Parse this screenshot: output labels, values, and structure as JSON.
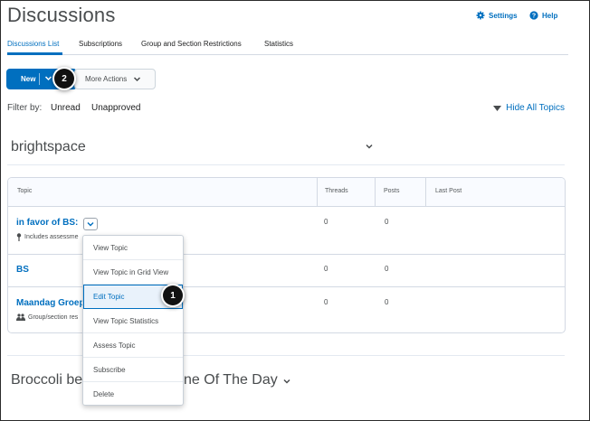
{
  "page": {
    "title": "Discussions"
  },
  "header_links": {
    "settings": "Settings",
    "help": "Help"
  },
  "tabs": [
    "Discussions List",
    "Subscriptions",
    "Group and Section Restrictions",
    "Statistics"
  ],
  "toolbar": {
    "new_label": "New",
    "more_actions_label": "More Actions"
  },
  "callouts": {
    "first": "1",
    "second": "2"
  },
  "filter": {
    "label": "Filter by:",
    "unread": "Unread",
    "unapproved": "Unapproved",
    "hide_all_topics": "Hide All Topics"
  },
  "forum": {
    "title": "brightspace"
  },
  "table": {
    "headers": {
      "topic": "Topic",
      "threads": "Threads",
      "posts": "Posts",
      "last_post": "Last Post"
    },
    "rows": [
      {
        "topic": "in favor of BS:",
        "note": "Includes assessme",
        "threads": "0",
        "posts": "0"
      },
      {
        "topic": "BS",
        "threads": "0",
        "posts": "0"
      },
      {
        "topic": "Maandag Groep",
        "note": "Group/section res",
        "threads": "0",
        "posts": "0"
      }
    ]
  },
  "context_menu": {
    "items": [
      "View Topic",
      "View Topic in Grid View",
      "Edit Topic",
      "View Topic Statistics",
      "Assess Topic",
      "Subscribe",
      "Delete"
    ],
    "highlighted": "Edit Topic"
  },
  "forum2": {
    "title_left": "Broccoli be",
    "title_right": "ne Of The Day"
  },
  "colors": {
    "accent": "#006fbf",
    "text": "#202122",
    "muted": "#494c4e",
    "border": "#d3d9e3"
  },
  "icons": {
    "settings": "gear-icon",
    "help": "help-circle-icon",
    "chevron": "chevron-down-icon",
    "triangle": "triangle-down-icon",
    "pin": "pin-icon",
    "group": "group-icon"
  }
}
